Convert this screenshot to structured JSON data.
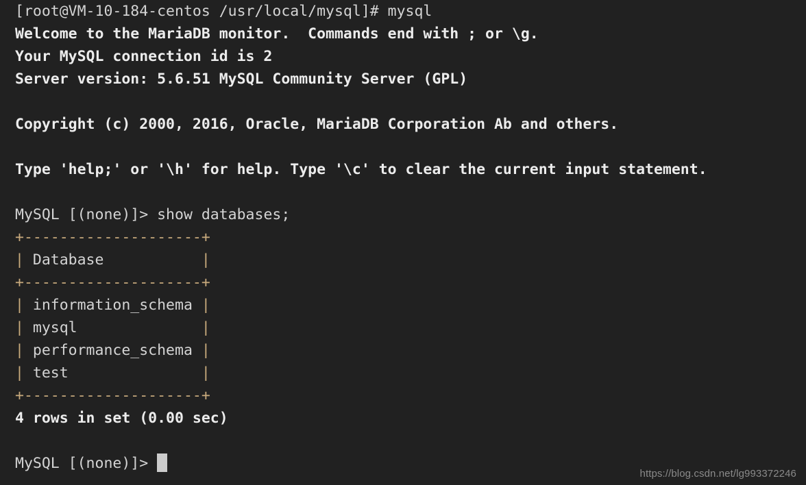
{
  "terminal": {
    "background_color": "#212121",
    "foreground_color": "#d4d4d4",
    "bold_color": "#ececec",
    "border_color": "#c9ab7d",
    "cursor_color": "#cccccc",
    "shell_prompt_line": "[root@VM-10-184-centos /usr/local/mysql]# mysql",
    "banner": {
      "welcome": "Welcome to the MariaDB monitor.  Commands end with ; or \\g.",
      "connection_id": "Your MySQL connection id is 2",
      "server_version": "Server version: 5.6.51 MySQL Community Server (GPL)",
      "copyright": "Copyright (c) 2000, 2016, Oracle, MariaDB Corporation Ab and others.",
      "help_hint": "Type 'help;' or '\\h' for help. Type '\\c' to clear the current input statement."
    },
    "query_prompt": "MySQL [(none)]> ",
    "query_command": "show databases;",
    "result_table": {
      "rule": "+--------------------+",
      "header_row": "| Database           |",
      "rows": [
        "| information_schema |",
        "| mysql              |",
        "| performance_schema |",
        "| test               |"
      ],
      "column_header": "Database",
      "databases": [
        "information_schema",
        "mysql",
        "performance_schema",
        "test"
      ]
    },
    "result_status": "4 rows in set (0.00 sec)",
    "final_prompt": "MySQL [(none)]> ",
    "cursor": "block-cursor"
  },
  "watermark": {
    "text": "https://blog.csdn.net/lg993372246"
  }
}
